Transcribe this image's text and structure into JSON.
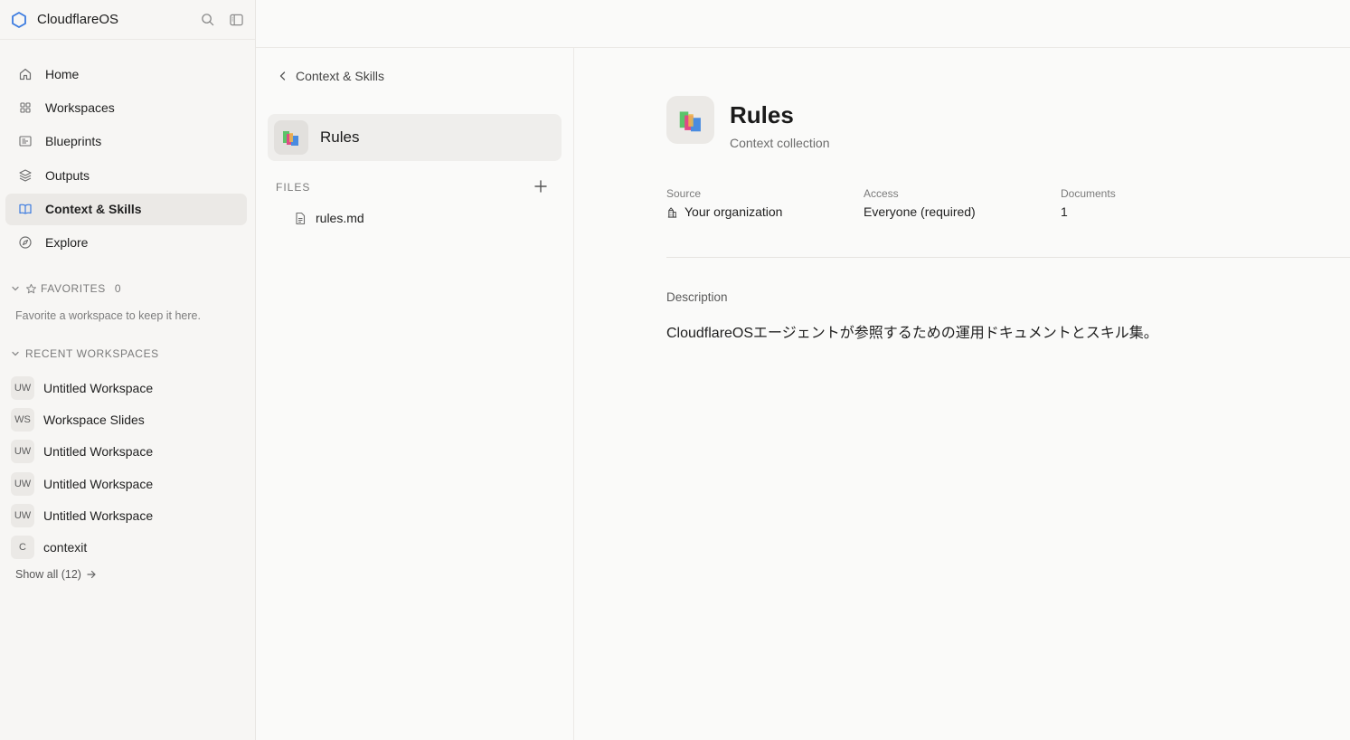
{
  "app": {
    "name": "CloudflareOS",
    "accent": "#3b7be0"
  },
  "sidebar": {
    "nav": [
      {
        "label": "Home",
        "icon": "home-icon"
      },
      {
        "label": "Workspaces",
        "icon": "grid-icon"
      },
      {
        "label": "Blueprints",
        "icon": "blueprint-icon"
      },
      {
        "label": "Outputs",
        "icon": "layers-icon"
      },
      {
        "label": "Context & Skills",
        "icon": "book-icon",
        "active": true
      },
      {
        "label": "Explore",
        "icon": "compass-icon"
      }
    ],
    "favorites": {
      "title": "FAVORITES",
      "count": "0",
      "empty_text": "Favorite a workspace to keep it here."
    },
    "recent": {
      "title": "RECENT WORKSPACES",
      "items": [
        {
          "initials": "UW",
          "name": "Untitled Workspace"
        },
        {
          "initials": "WS",
          "name": "Workspace Slides"
        },
        {
          "initials": "UW",
          "name": "Untitled Workspace"
        },
        {
          "initials": "UW",
          "name": "Untitled Workspace"
        },
        {
          "initials": "UW",
          "name": "Untitled Workspace"
        },
        {
          "initials": "C",
          "name": "contexit"
        }
      ],
      "show_all": "Show all (12)"
    }
  },
  "middle": {
    "back_label": "Context & Skills",
    "collection": {
      "name": "Rules"
    },
    "files_title": "FILES",
    "files": [
      {
        "name": "rules.md"
      }
    ]
  },
  "detail": {
    "title": "Rules",
    "subtitle": "Context collection",
    "meta": {
      "source_label": "Source",
      "source_value": "Your organization",
      "access_label": "Access",
      "access_value": "Everyone (required)",
      "documents_label": "Documents",
      "documents_value": "1"
    },
    "description_label": "Description",
    "description": "CloudflareOSエージェントが参照するための運用ドキュメントとスキル集。"
  }
}
